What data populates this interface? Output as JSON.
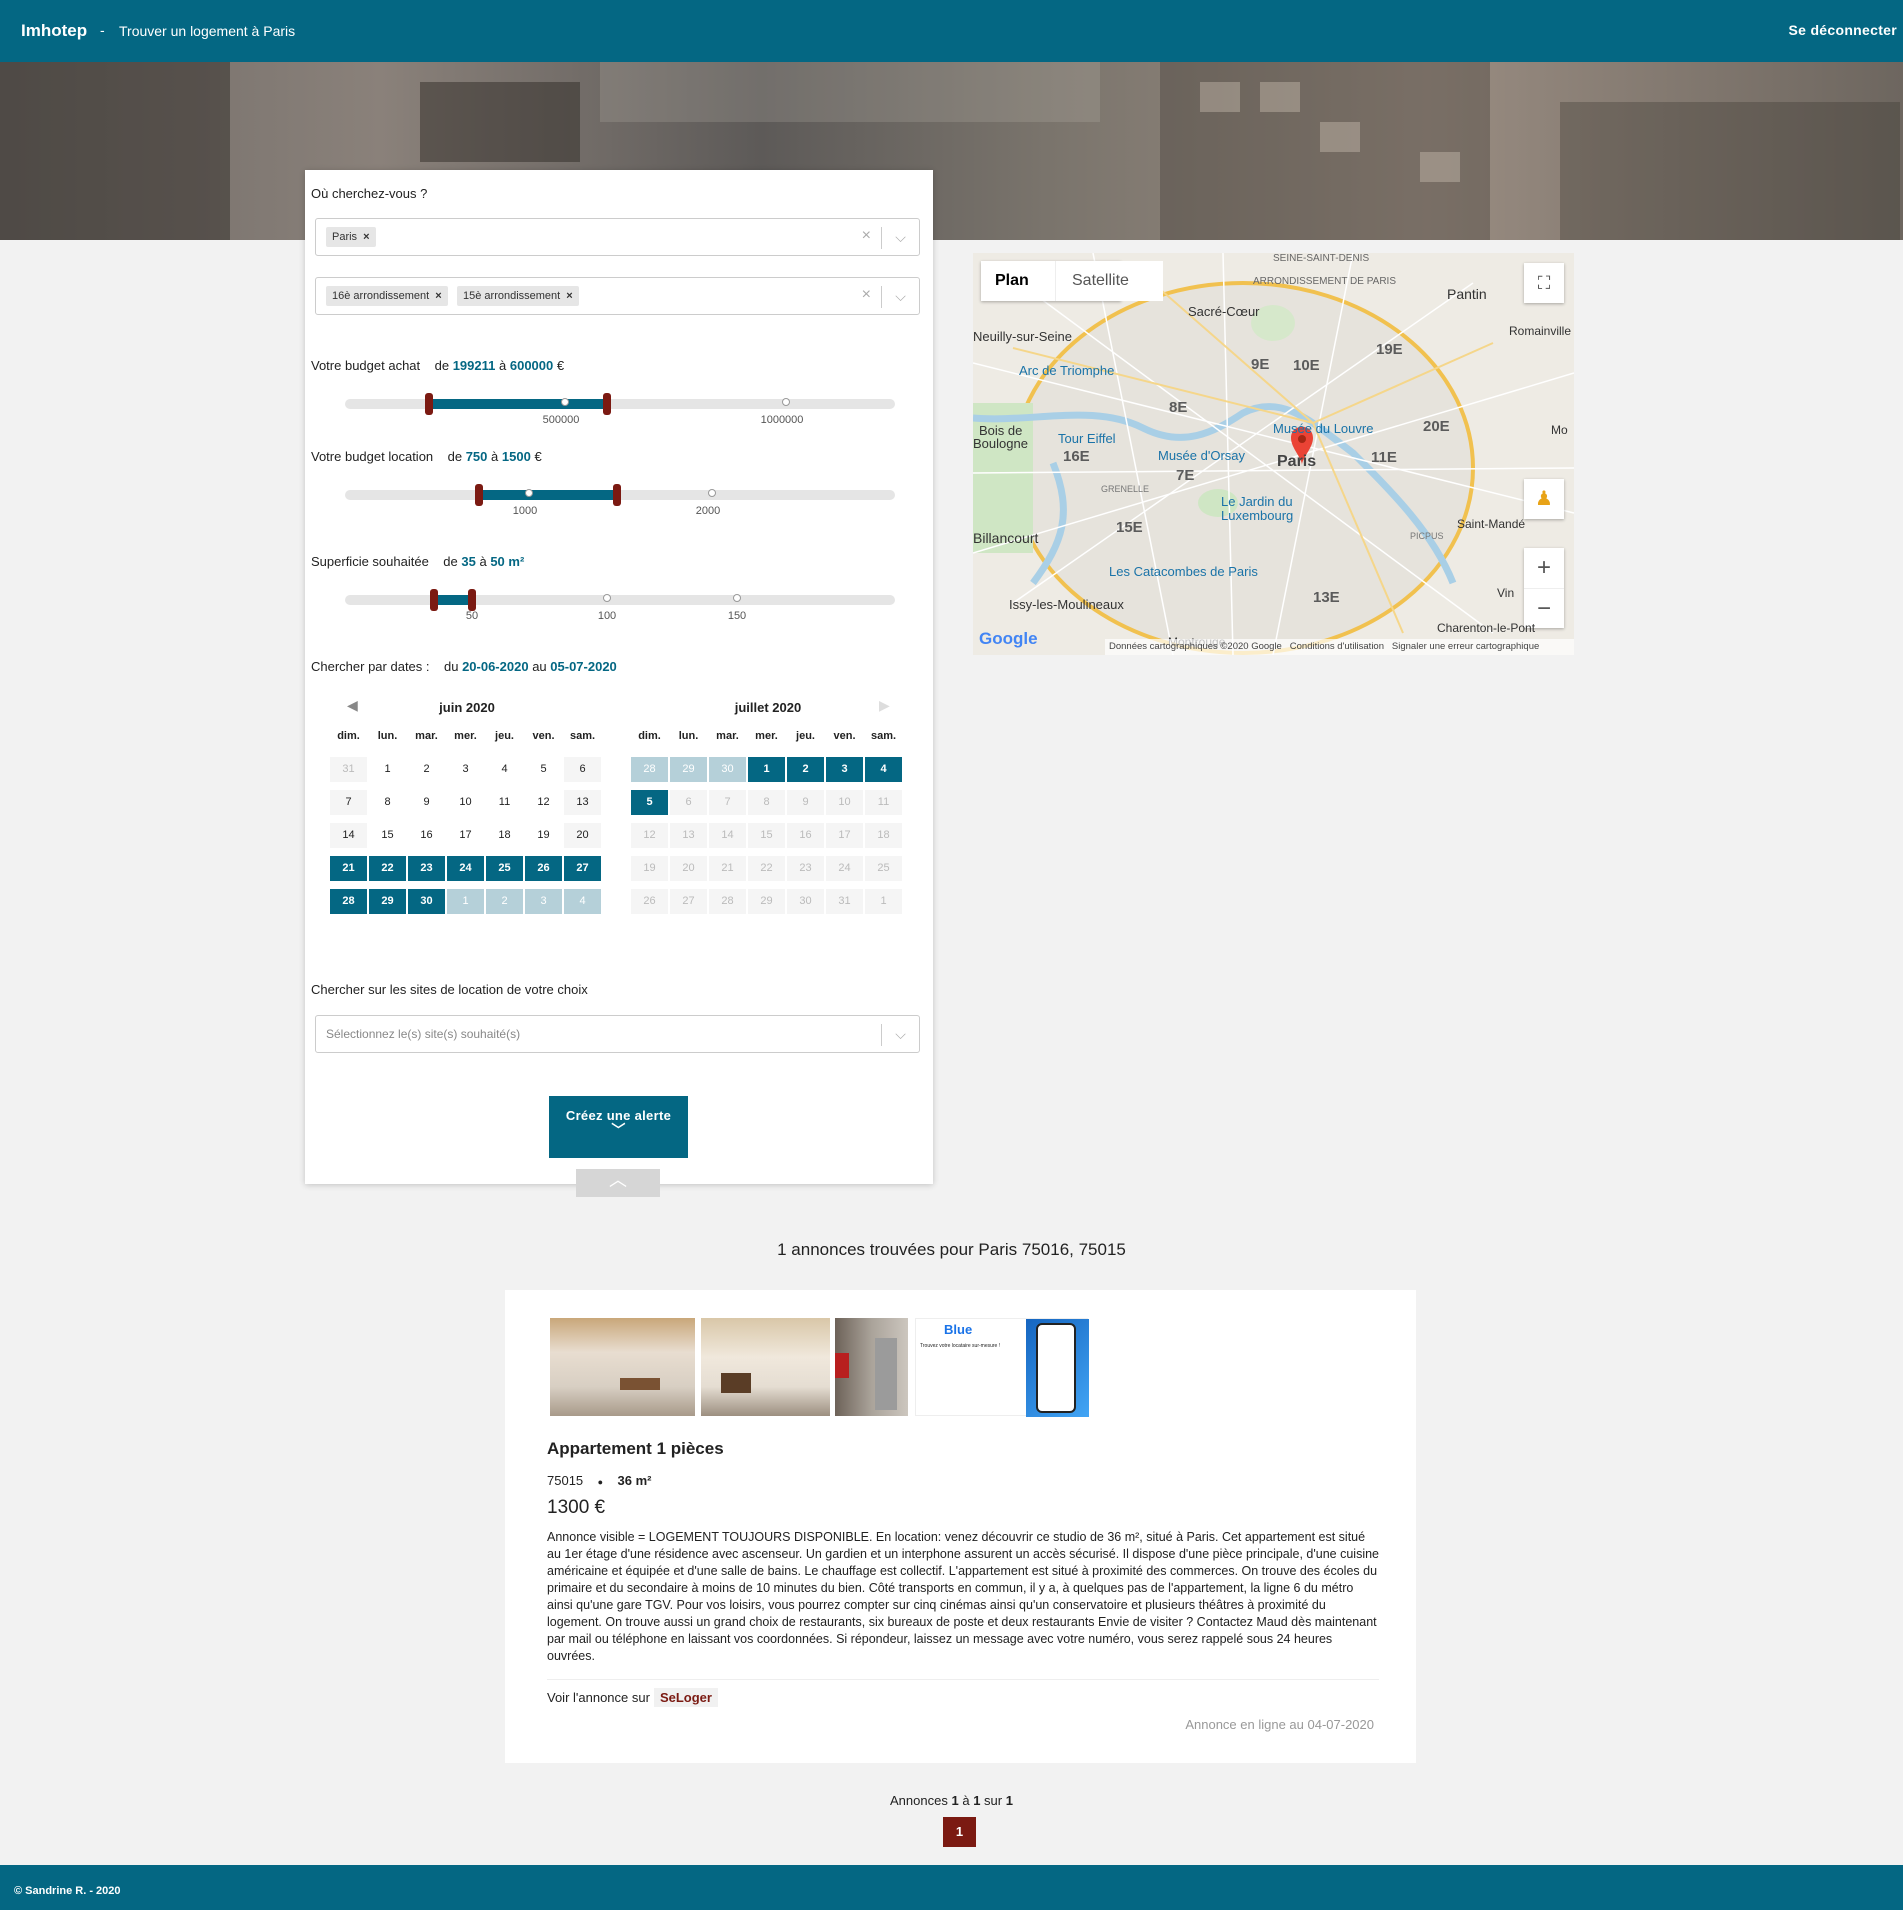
{
  "header": {
    "brand": "Imhotep",
    "separator": "-",
    "subtitle": "Trouver un logement à Paris",
    "logout": "Se déconnecter"
  },
  "search": {
    "where_label": "Où cherchez-vous ?",
    "city_tags": [
      {
        "label": "Paris"
      }
    ],
    "district_tags": [
      {
        "label": "16è arrondissement"
      },
      {
        "label": "15è arrondissement"
      }
    ],
    "budget_buy": {
      "label": "Votre budget achat",
      "from_word": "de",
      "min": "199211",
      "to_word": "à",
      "max": "600000",
      "unit": "€",
      "ticks": [
        "500000",
        "1000000"
      ]
    },
    "budget_rent": {
      "label": "Votre budget location",
      "from_word": "de",
      "min": "750",
      "to_word": "à",
      "max": "1500",
      "unit": "€",
      "ticks": [
        "1000",
        "2000"
      ]
    },
    "surface": {
      "label": "Superficie souhaitée",
      "from_word": "de",
      "min": "35",
      "to_word": "à",
      "max": "50",
      "unit": "m²",
      "ticks": [
        "50",
        "100",
        "150"
      ]
    },
    "dates": {
      "label": "Chercher par dates :",
      "from_word": "du",
      "start": "20-06-2020",
      "to_word": "au",
      "end": "05-07-2020"
    },
    "sites": {
      "label": "Chercher sur les sites de location de votre choix",
      "placeholder": "Sélectionnez le(s) site(s) souhaité(s)"
    },
    "alert_button": "Créez une alerte",
    "clear_icon": "×",
    "dropdown_icon": "⌵",
    "chevron_down": "﹀",
    "chevron_up": "︿"
  },
  "calendar": {
    "weekdays": [
      "dim.",
      "lun.",
      "mar.",
      "mer.",
      "jeu.",
      "ven.",
      "sam."
    ],
    "june": {
      "title": "juin 2020",
      "days": [
        "31",
        "1",
        "2",
        "3",
        "4",
        "5",
        "6",
        "7",
        "8",
        "9",
        "10",
        "11",
        "12",
        "13",
        "14",
        "15",
        "16",
        "17",
        "18",
        "19",
        "20",
        "21",
        "22",
        "23",
        "24",
        "25",
        "26",
        "27",
        "28",
        "29",
        "30",
        "1",
        "2",
        "3",
        "4"
      ]
    },
    "july": {
      "title": "juillet 2020",
      "days": [
        "28",
        "29",
        "30",
        "1",
        "2",
        "3",
        "4",
        "5",
        "6",
        "7",
        "8",
        "9",
        "10",
        "11",
        "12",
        "13",
        "14",
        "15",
        "16",
        "17",
        "18",
        "19",
        "20",
        "21",
        "22",
        "23",
        "24",
        "25",
        "26",
        "27",
        "28",
        "29",
        "30",
        "31",
        "1"
      ]
    }
  },
  "map": {
    "tab_plan": "Plan",
    "tab_satellite": "Satellite",
    "labels": [
      {
        "t": "Sacré-Cœur"
      },
      {
        "t": "Arc de Triomphe"
      },
      {
        "t": "Musée du Louvre"
      },
      {
        "t": "Tour Eiffel"
      },
      {
        "t": "Musée d'Orsay"
      },
      {
        "t": "Paris"
      },
      {
        "t": "Le Jardin du"
      },
      {
        "t": "Luxembourg"
      },
      {
        "t": "Les Catacombes de Paris"
      },
      {
        "t": "Billancourt"
      },
      {
        "t": "Issy-les-Moulineaux"
      },
      {
        "t": "Neuilly-sur-Seine"
      },
      {
        "t": "Bois de"
      },
      {
        "t": "Boulogne"
      },
      {
        "t": "Pantin"
      },
      {
        "t": "Romainville"
      },
      {
        "t": "Saint-Mandé"
      },
      {
        "t": "Charenton-le-Pont"
      },
      {
        "t": "ARRONDISSEMENT DE PARIS"
      },
      {
        "t": "SEINE-SAINT-DENIS"
      },
      {
        "t": "GRENELLE"
      },
      {
        "t": "PICPUS"
      },
      {
        "t": "Montrouge"
      },
      {
        "t": "Vin"
      },
      {
        "t": "Mo"
      }
    ],
    "arrondissements": [
      {
        "t": "9E"
      },
      {
        "t": "10E"
      },
      {
        "t": "19E"
      },
      {
        "t": "8E"
      },
      {
        "t": "20E"
      },
      {
        "t": "16E"
      },
      {
        "t": "7E"
      },
      {
        "t": "11E"
      },
      {
        "t": "15E"
      },
      {
        "t": "13E"
      }
    ],
    "attribution": "Données cartographiques ©2020 Google",
    "terms": "Conditions d'utilisation",
    "report": "Signaler une erreur cartographique",
    "google": "Google",
    "zoom_in": "+",
    "zoom_out": "−"
  },
  "results": {
    "summary": "1 annonces trouvées pour Paris 75016, 75015"
  },
  "listing": {
    "title": "Appartement 1 pièces",
    "postcode": "75015",
    "bullet": "●",
    "area": "36 m²",
    "price": "1300 €",
    "description": "Annonce visible = LOGEMENT TOUJOURS DISPONIBLE. En location: venez découvrir ce studio de 36 m², situé à Paris. Cet appartement est situé au 1er étage d'une résidence avec ascenseur. Un gardien et un interphone assurent un accès sécurisé. Il dispose d'une pièce principale, d'une cuisine américaine et équipée et d'une salle de bains. Le chauffage est collectif. L'appartement est situé à proximité des commerces. On trouve des écoles du primaire et du secondaire à moins de 10 minutes du bien. Côté transports en commun, il y a, à quelques pas de l'appartement, la ligne 6 du métro ainsi qu'une gare TGV. Pour vos loisirs, vous pourrez compter sur cinq cinémas ainsi qu'un conservatoire et plusieurs théâtres à proximité du logement. On trouve aussi un grand choix de restaurants, six bureaux de poste et deux restaurants Envie de visiter ? Contactez Maud dès maintenant par mail ou téléphone en laissant vos coordonnées. Si répondeur, laissez un message avec votre numéro, vous serez rappelé sous 24 heures ouvrées.",
    "link_label": "Voir l'annonce sur",
    "link_site": "SeLoger",
    "online_date": "Annonce en ligne au 04-07-2020",
    "ad_brand": "Blue",
    "ad_line": "Trouvez votre locataire sur-mesure !"
  },
  "pagination": {
    "prefix": "Annonces",
    "from": "1",
    "to_word": "à",
    "to": "1",
    "of_word": "sur",
    "total": "1",
    "current": "1"
  },
  "footer": {
    "text": "© Sandrine R. - 2020"
  }
}
